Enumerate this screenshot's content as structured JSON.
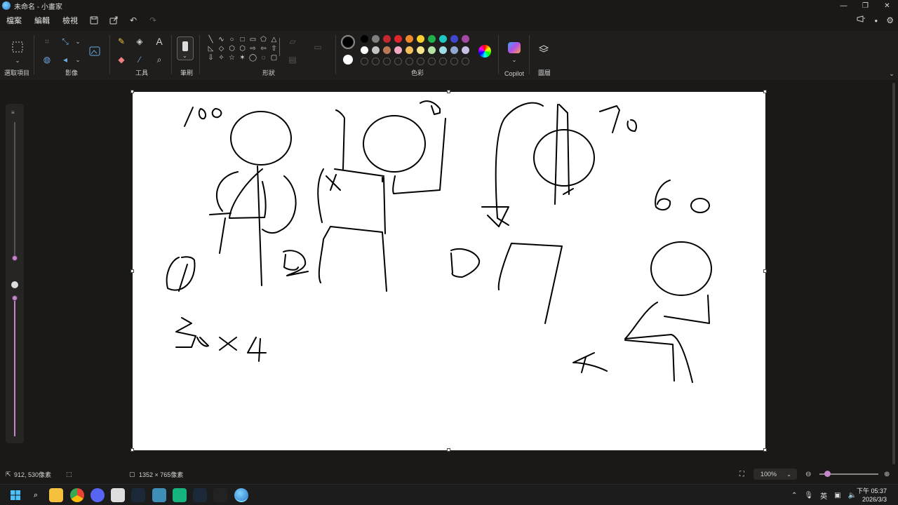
{
  "window": {
    "title": "未命名 - 小畫家",
    "minimize": "—",
    "restore": "❐",
    "close": "✕"
  },
  "menu": {
    "items": [
      "檔案",
      "編輯",
      "檢視"
    ],
    "save_icon": "save-icon",
    "share_icon": "share-icon",
    "undo_icon": "undo-icon",
    "redo_icon": "redo-icon"
  },
  "ribbon": {
    "groups": {
      "selection": "選取項目",
      "image": "影像",
      "tools": "工具",
      "brushes": "筆刷",
      "shapes": "形狀",
      "colors": "色彩",
      "copilot": "Copilot",
      "layers": "圖層"
    },
    "shape_glyphs": [
      "╲",
      "∿",
      "○",
      "□",
      "▭",
      "⬠",
      "△",
      "◺",
      "◇",
      "⬡",
      "⬡",
      "⇨",
      "⇦",
      "⇧",
      "⇩",
      "✧",
      "☆",
      "✶",
      "◯",
      "◌",
      "▢"
    ],
    "palette_row1": [
      "#000000",
      "#7f7f7f",
      "#c3282e",
      "#e0262d",
      "#f0892b",
      "#fad02c",
      "#1fb14b",
      "#1ec7c1",
      "#3f48cc",
      "#a349a4"
    ],
    "palette_row2": [
      "#ffffff",
      "#c3c3c3",
      "#b97a57",
      "#f3a8c4",
      "#f6bf5b",
      "#f6e58d",
      "#b6e3a5",
      "#9edde4",
      "#8fa7d1",
      "#c8bfe7"
    ],
    "primary_color": "#000000",
    "secondary_color": "#ffffff"
  },
  "status": {
    "cursor_pos": "912, 530像素",
    "canvas_size": "1352 × 765像素",
    "zoom": "100%"
  },
  "taskbar": {
    "lang": "英",
    "time": "下午 05:37",
    "date": "2026/3/3",
    "icons": [
      "start-icon",
      "search-icon",
      "file-explorer-icon",
      "chrome-icon",
      "discord-icon",
      "app-icon",
      "steam-icon",
      "app2-icon",
      "app3-icon",
      "steam2-icon",
      "cat-icon",
      "paint-icon"
    ]
  },
  "canvas_text": {
    "note1": "/00",
    "note2": "30 x 4",
    "note3": "60"
  }
}
